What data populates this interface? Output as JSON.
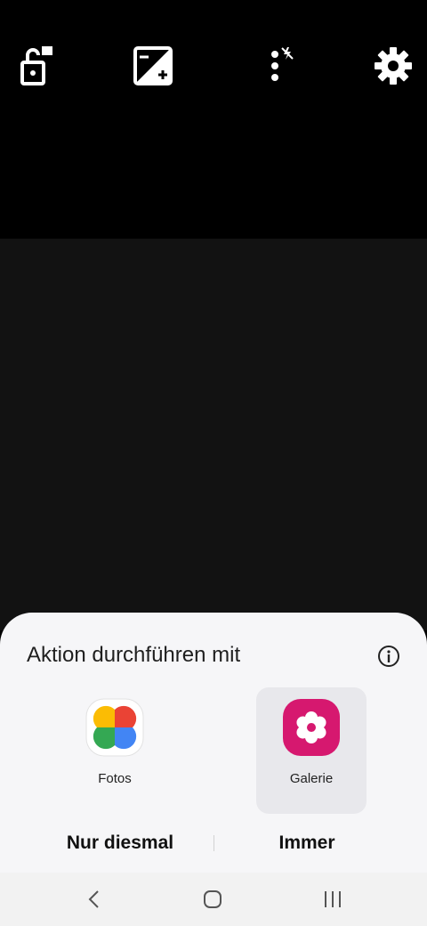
{
  "camera_toolbar": {
    "icons": [
      "camera-lock-icon",
      "exposure-icon",
      "more-flash-off-icon",
      "gear-icon"
    ]
  },
  "chooser": {
    "title": "Aktion durchführen mit",
    "apps": [
      {
        "label": "Fotos",
        "icon": "google-photos-icon",
        "selected": false
      },
      {
        "label": "Galerie",
        "icon": "gallery-flower-icon",
        "selected": true,
        "brand_color": "#d6186f"
      }
    ],
    "just_once_label": "Nur diesmal",
    "always_label": "Immer"
  },
  "navbar": {
    "icons": [
      "back-icon",
      "home-icon",
      "recents-icon"
    ]
  }
}
